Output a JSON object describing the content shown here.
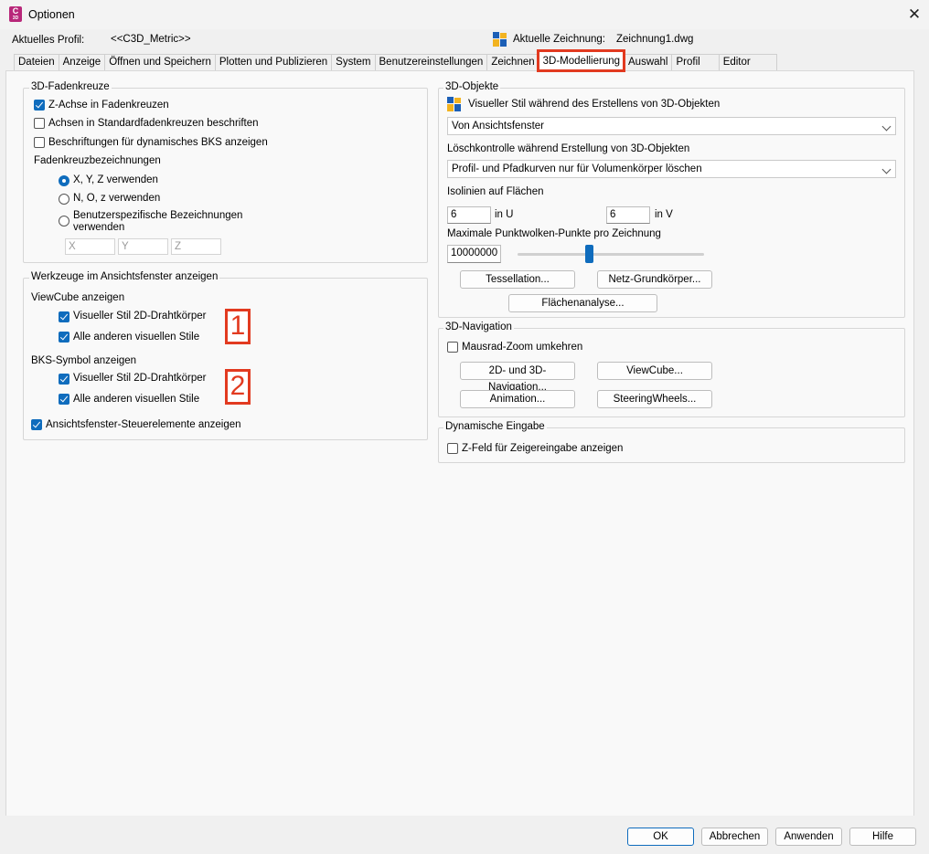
{
  "window": {
    "title": "Optionen",
    "close_glyph": "✕",
    "icon_letter": "C",
    "icon_small": "3D"
  },
  "header": {
    "profile_label": "Aktuelles Profil:",
    "profile_value": "<<C3D_Metric>>",
    "drawing_label": "Aktuelle Zeichnung:",
    "drawing_value": "Zeichnung1.dwg"
  },
  "tabs": [
    {
      "label": "Dateien"
    },
    {
      "label": "Anzeige"
    },
    {
      "label": "Öffnen und Speichern"
    },
    {
      "label": "Plotten und Publizieren"
    },
    {
      "label": "System"
    },
    {
      "label": "Benutzereinstellungen"
    },
    {
      "label": "Zeichnen"
    },
    {
      "label": "3D-Modellierung"
    },
    {
      "label": "Auswahl"
    },
    {
      "label": "Profil"
    },
    {
      "label": "Editor"
    }
  ],
  "active_tab": "3D-Modellierung",
  "crosshair": {
    "group_label": "3D-Fadenkreuze",
    "z_axis": {
      "label": "Z-Achse in Fadenkreuzen",
      "checked": true
    },
    "label_axes": {
      "label": "Achsen in Standardfadenkreuzen beschriften",
      "checked": false
    },
    "dyn_ucs": {
      "label": "Beschriftungen für dynamisches BKS anzeigen",
      "checked": false
    },
    "naming_label": "Fadenkreuzbezeichnungen",
    "radio_xyz": "X, Y, Z verwenden",
    "radio_noz": "N, O, z verwenden",
    "radio_custom_1": "Benutzerspezifische Bezeichnungen",
    "radio_custom_2": "verwenden",
    "selected": "xyz",
    "custom_x": "X",
    "custom_y": "Y",
    "custom_z": "Z"
  },
  "viewport_tools": {
    "group_label": "Werkzeuge im Ansichtsfenster anzeigen",
    "viewcube_label": "ViewCube anzeigen",
    "vc_2d": "Visueller Stil 2D-Drahtkörper",
    "vc_other": "Alle anderen visuellen Stile",
    "ucs_label": "BKS-Symbol anzeigen",
    "ucs_2d": "Visueller Stil 2D-Drahtkörper",
    "ucs_other": "Alle anderen visuellen Stile",
    "viewport_controls": "Ansichtsfenster-Steuerelemente anzeigen",
    "marker_1": "1",
    "marker_2": "2"
  },
  "objects3d": {
    "group_label": "3D-Objekte",
    "visual_style_label": "Visueller Stil während des Erstellens von 3D-Objekten",
    "visual_style_value": "Von Ansichtsfenster",
    "delete_label": "Löschkontrolle während Erstellung von 3D-Objekten",
    "delete_value": "Profil- und Pfadkurven nur für Volumenkörper löschen",
    "isolines_label": "Isolinien auf Flächen",
    "iso_u_value": "6",
    "iso_u_label": "in U",
    "iso_v_value": "6",
    "iso_v_label": "in V",
    "pointcloud_label": "Maximale Punktwolken-Punkte pro Zeichnung",
    "pointcloud_value": "10000000",
    "slider_fraction": 0.38,
    "btn_tessellation": "Tessellation...",
    "btn_mesh": "Netz-Grundkörper...",
    "btn_surface": "Flächenanalyse..."
  },
  "navigation3d": {
    "group_label": "3D-Navigation",
    "reverse_zoom": "Mausrad-Zoom umkehren",
    "btn_nav": "2D- und 3D-Navigation...",
    "btn_viewcube": "ViewCube...",
    "btn_animation": "Animation...",
    "btn_steering": "SteeringWheels..."
  },
  "dynamic_input": {
    "group_label": "Dynamische Eingabe",
    "z_field": "Z-Feld für Zeigereingabe anzeigen"
  },
  "footer": {
    "ok": "OK",
    "cancel": "Abbrechen",
    "apply": "Anwenden",
    "help": "Hilfe"
  },
  "colors": {
    "accent": "#0f6cbd",
    "highlight": "#e23a20",
    "app_icon": "#b8287a"
  }
}
